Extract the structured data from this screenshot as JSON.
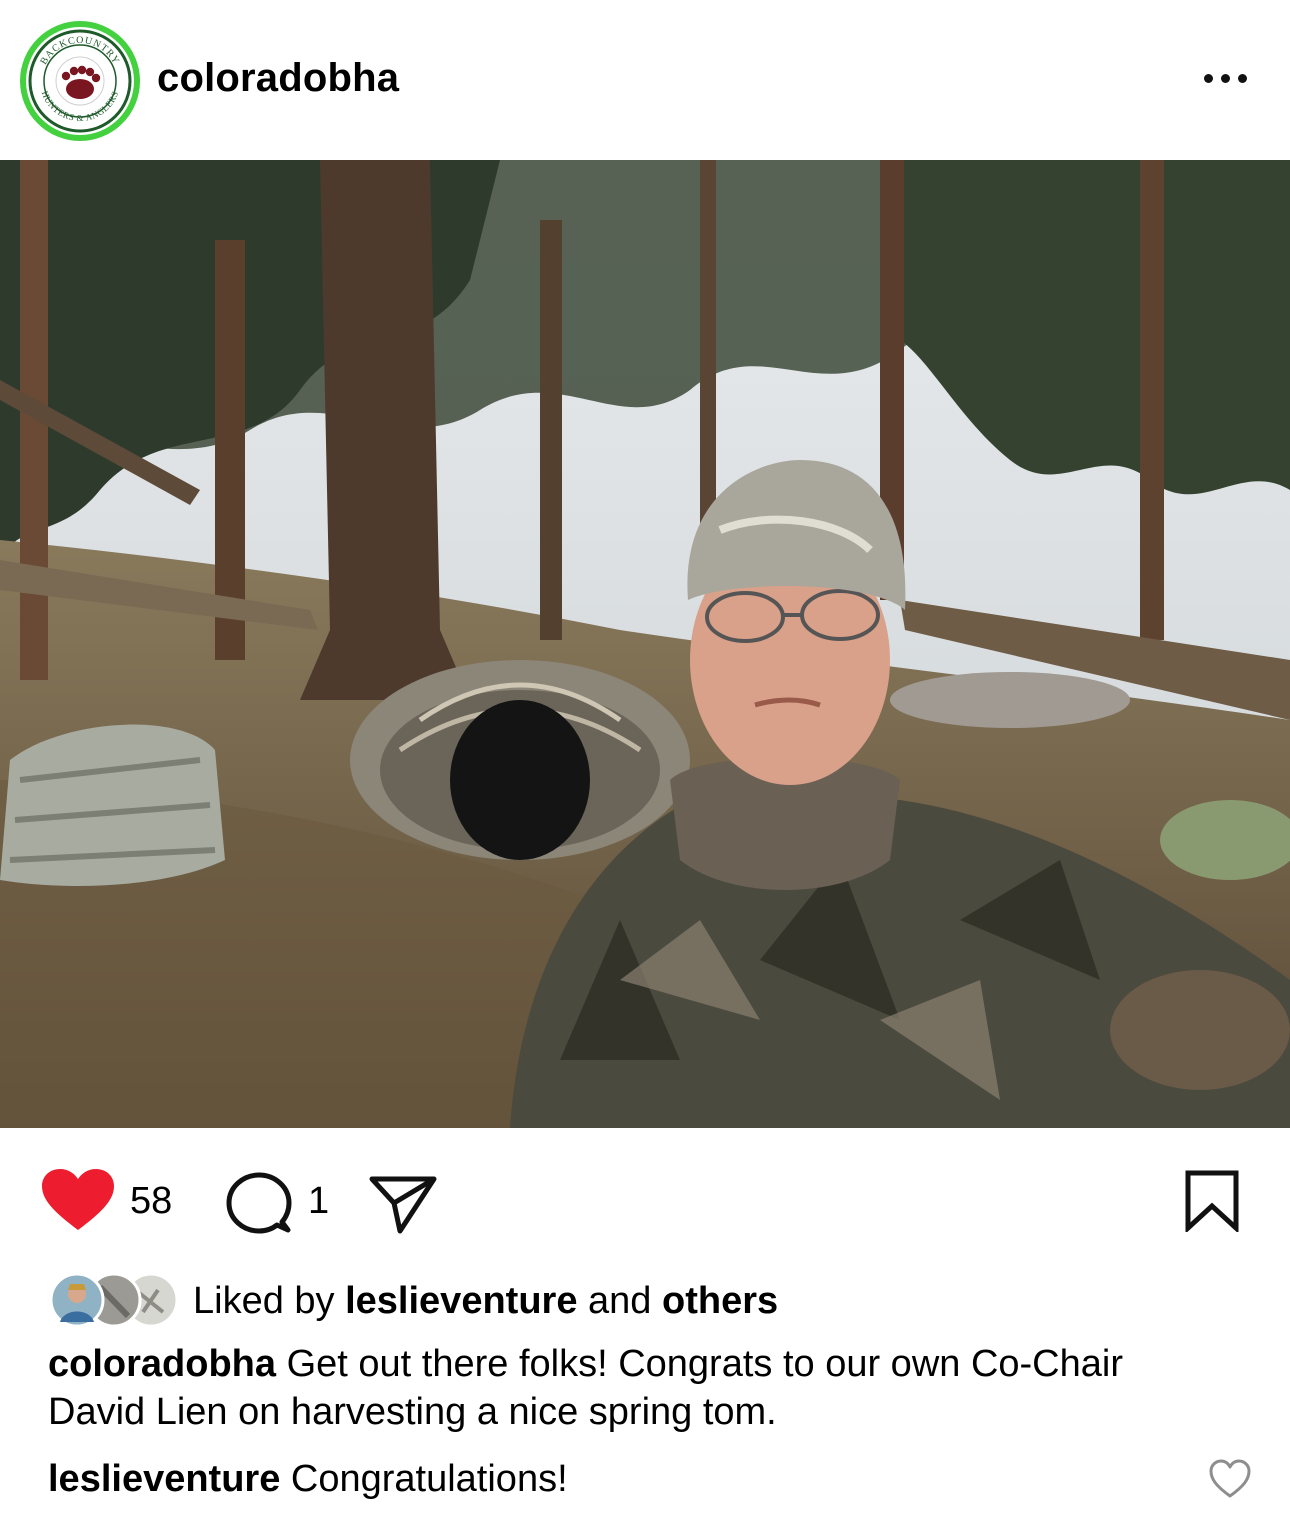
{
  "post": {
    "username": "coloradobha",
    "avatar_text_top": "BACKCOUNTRY",
    "avatar_text_bottom": "HUNTERS & ANGLERS",
    "more_icon": "more-horizontal-icon",
    "photo_description_icon": "post-photo"
  },
  "actions": {
    "like_icon": "heart-filled-icon",
    "like_color": "#ed1c2e",
    "like_count": "58",
    "comment_icon": "comment-icon",
    "comment_count": "1",
    "share_icon": "send-icon",
    "save_icon": "bookmark-icon"
  },
  "liked_by": {
    "prefix": "Liked by",
    "user": "leslieventure",
    "middle": "and",
    "suffix": "others"
  },
  "caption": {
    "username": "coloradobha",
    "text": "Get out there folks!  Congrats to our own Co-Chair David Lien on harvesting a nice spring tom."
  },
  "comments": [
    {
      "username": "leslieventure",
      "text": "Congratulations!",
      "like_icon": "heart-outline-icon"
    }
  ]
}
